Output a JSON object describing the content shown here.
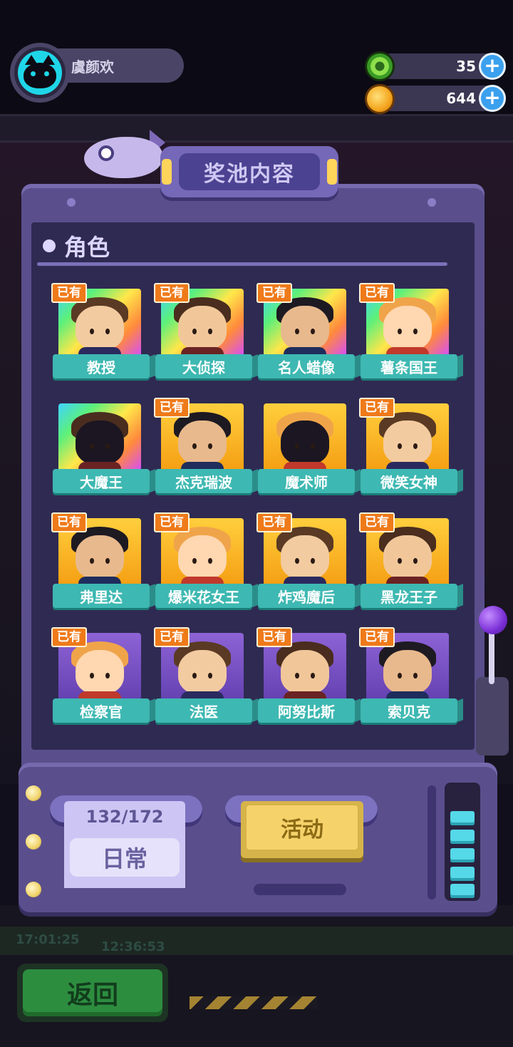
{
  "header": {
    "player_name": "虞颜欢",
    "resources": [
      {
        "icon": "green-donut-icon",
        "amount": "35"
      },
      {
        "icon": "gold-planet-coin-icon",
        "amount": "644"
      }
    ],
    "plus_label": "+"
  },
  "panel": {
    "title": "奖池内容",
    "section_label": "角色"
  },
  "owned_badge": "已有",
  "characters": [
    {
      "name": "教授",
      "owned": true,
      "frame": "rainbow"
    },
    {
      "name": "大侦探",
      "owned": true,
      "frame": "rainbow"
    },
    {
      "name": "名人蜡像",
      "owned": true,
      "frame": "rainbow"
    },
    {
      "name": "薯条国王",
      "owned": true,
      "frame": "rainbow"
    },
    {
      "name": "大魔王",
      "owned": false,
      "frame": "rainbow"
    },
    {
      "name": "杰克瑞波",
      "owned": true,
      "frame": "gold"
    },
    {
      "name": "魔术师",
      "owned": false,
      "frame": "gold"
    },
    {
      "name": "微笑女神",
      "owned": true,
      "frame": "gold"
    },
    {
      "name": "弗里达",
      "owned": true,
      "frame": "gold"
    },
    {
      "name": "爆米花女王",
      "owned": true,
      "frame": "gold"
    },
    {
      "name": "炸鸡魔后",
      "owned": true,
      "frame": "gold"
    },
    {
      "name": "黑龙王子",
      "owned": true,
      "frame": "gold"
    },
    {
      "name": "检察官",
      "owned": true,
      "frame": "purple"
    },
    {
      "name": "法医",
      "owned": true,
      "frame": "purple"
    },
    {
      "name": "阿努比斯",
      "owned": true,
      "frame": "purple"
    },
    {
      "name": "索贝克",
      "owned": true,
      "frame": "purple"
    }
  ],
  "pool_tabs": {
    "daily": {
      "count": "132/172",
      "label": "日常"
    },
    "event": {
      "label": "活动"
    }
  },
  "back_button": "返回",
  "background_timers": [
    "17:01:25",
    "12:36:53"
  ]
}
